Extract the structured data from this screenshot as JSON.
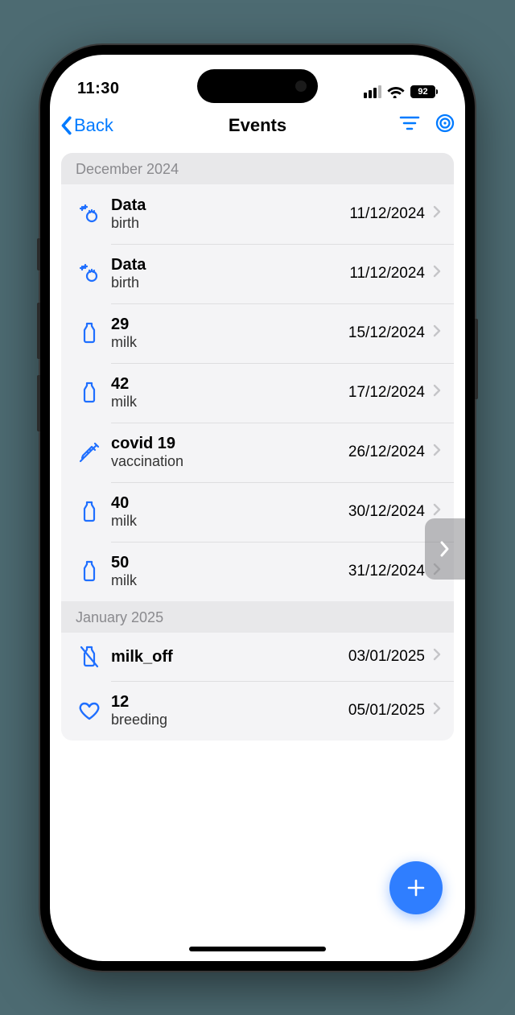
{
  "status": {
    "time": "11:30",
    "battery": "92"
  },
  "nav": {
    "back": "Back",
    "title": "Events"
  },
  "sections": [
    {
      "header": "December 2024",
      "rows": [
        {
          "icon": "birth",
          "title": "Data",
          "sub": "birth",
          "date": "11/12/2024"
        },
        {
          "icon": "birth",
          "title": "Data",
          "sub": "birth",
          "date": "11/12/2024"
        },
        {
          "icon": "milk",
          "title": "29",
          "sub": "milk",
          "date": "15/12/2024"
        },
        {
          "icon": "milk",
          "title": "42",
          "sub": "milk",
          "date": "17/12/2024"
        },
        {
          "icon": "syringe",
          "title": "covid 19",
          "sub": "vaccination",
          "date": "26/12/2024"
        },
        {
          "icon": "milk",
          "title": "40",
          "sub": "milk",
          "date": "30/12/2024"
        },
        {
          "icon": "milk",
          "title": "50",
          "sub": "milk",
          "date": "31/12/2024"
        }
      ]
    },
    {
      "header": "January 2025",
      "rows": [
        {
          "icon": "milk_off",
          "title": "milk_off",
          "sub": "",
          "date": "03/01/2025"
        },
        {
          "icon": "heart",
          "title": "12",
          "sub": "breeding",
          "date": "05/01/2025"
        }
      ]
    }
  ]
}
